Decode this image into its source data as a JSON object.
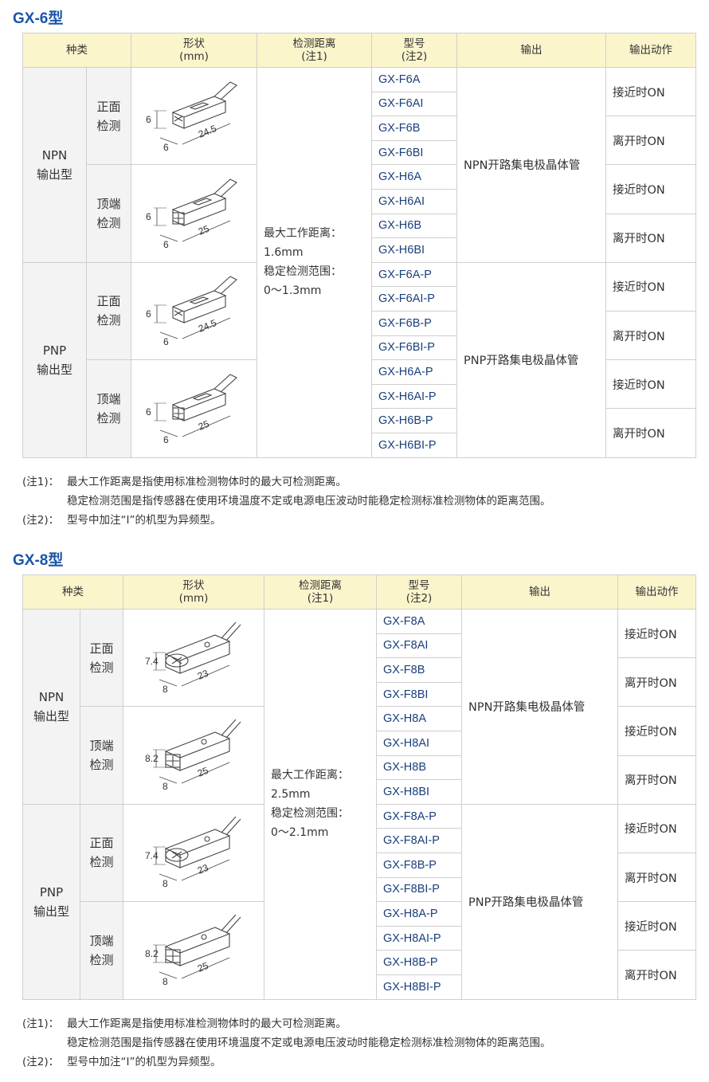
{
  "sections": [
    {
      "title": "GX-6型",
      "headers": {
        "type": "种类",
        "shape": "形状\n(mm)",
        "dist": "检测距离\n(注1)",
        "model": "型号\n(注2)",
        "output": "输出",
        "action": "输出动作"
      },
      "groups": [
        {
          "type": "NPN\n输出型",
          "output": "NPN开路集电极晶体管",
          "subs": [
            {
              "label": "正面\n检测",
              "dims": [
                "6",
                "6",
                "24.5"
              ],
              "models": [
                "GX-F6A",
                "GX-F6AI",
                "GX-F6B",
                "GX-F6BI"
              ],
              "actions": [
                "接近时ON",
                "离开时ON"
              ]
            },
            {
              "label": "顶端\n检测",
              "dims": [
                "6",
                "6",
                "25"
              ],
              "models": [
                "GX-H6A",
                "GX-H6AI",
                "GX-H6B",
                "GX-H6BI"
              ],
              "actions": [
                "接近时ON",
                "离开时ON"
              ]
            }
          ]
        },
        {
          "type": "PNP\n输出型",
          "output": "PNP开路集电极晶体管",
          "subs": [
            {
              "label": "正面\n检测",
              "dims": [
                "6",
                "6",
                "24.5"
              ],
              "models": [
                "GX-F6A-P",
                "GX-F6AI-P",
                "GX-F6B-P",
                "GX-F6BI-P"
              ],
              "actions": [
                "接近时ON",
                "离开时ON"
              ]
            },
            {
              "label": "顶端\n检测",
              "dims": [
                "6",
                "6",
                "25"
              ],
              "models": [
                "GX-H6A-P",
                "GX-H6AI-P",
                "GX-H6B-P",
                "GX-H6BI-P"
              ],
              "actions": [
                "接近时ON",
                "离开时ON"
              ]
            }
          ]
        }
      ],
      "distance": [
        "最大工作距离：",
        "1.6mm",
        "稳定检测范围：",
        "0～1.3mm"
      ],
      "notes": [
        {
          "label": "(注1)：",
          "lines": [
            "最大工作距离是指使用标准检测物体时的最大可检测距离。",
            "稳定检测范围是指传感器在使用环境温度不定或电源电压波动时能稳定检测标准检测物体的距离范围。"
          ]
        },
        {
          "label": "(注2)：",
          "lines": [
            "型号中加注“I”的机型为异频型。"
          ]
        }
      ]
    },
    {
      "title": "GX-8型",
      "headers": {
        "type": "种类",
        "shape": "形状\n(mm)",
        "dist": "检测距离\n(注1)",
        "model": "型号\n(注2)",
        "output": "输出",
        "action": "输出动作"
      },
      "groups": [
        {
          "type": "NPN\n输出型",
          "output": "NPN开路集电极晶体管",
          "subs": [
            {
              "label": "正面\n检测",
              "dims": [
                "7.4",
                "8",
                "23"
              ],
              "models": [
                "GX-F8A",
                "GX-F8AI",
                "GX-F8B",
                "GX-F8BI"
              ],
              "actions": [
                "接近时ON",
                "离开时ON"
              ]
            },
            {
              "label": "顶端\n检测",
              "dims": [
                "8.2",
                "8",
                "25"
              ],
              "models": [
                "GX-H8A",
                "GX-H8AI",
                "GX-H8B",
                "GX-H8BI"
              ],
              "actions": [
                "接近时ON",
                "离开时ON"
              ]
            }
          ]
        },
        {
          "type": "PNP\n输出型",
          "output": "PNP开路集电极晶体管",
          "subs": [
            {
              "label": "正面\n检测",
              "dims": [
                "7.4",
                "8",
                "23"
              ],
              "models": [
                "GX-F8A-P",
                "GX-F8AI-P",
                "GX-F8B-P",
                "GX-F8BI-P"
              ],
              "actions": [
                "接近时ON",
                "离开时ON"
              ]
            },
            {
              "label": "顶端\n检测",
              "dims": [
                "8.2",
                "8",
                "25"
              ],
              "models": [
                "GX-H8A-P",
                "GX-H8AI-P",
                "GX-H8B-P",
                "GX-H8BI-P"
              ],
              "actions": [
                "接近时ON",
                "离开时ON"
              ]
            }
          ]
        }
      ],
      "distance": [
        "最大工作距离：",
        "2.5mm",
        "稳定检测范围：",
        "0～2.1mm"
      ],
      "notes": [
        {
          "label": "(注1)：",
          "lines": [
            "最大工作距离是指使用标准检测物体时的最大可检测距离。",
            "稳定检测范围是指传感器在使用环境温度不定或电源电压波动时能稳定检测标准检测物体的距离范围。"
          ]
        },
        {
          "label": "(注2)：",
          "lines": [
            "型号中加注“I”的机型为异频型。"
          ]
        }
      ]
    }
  ]
}
